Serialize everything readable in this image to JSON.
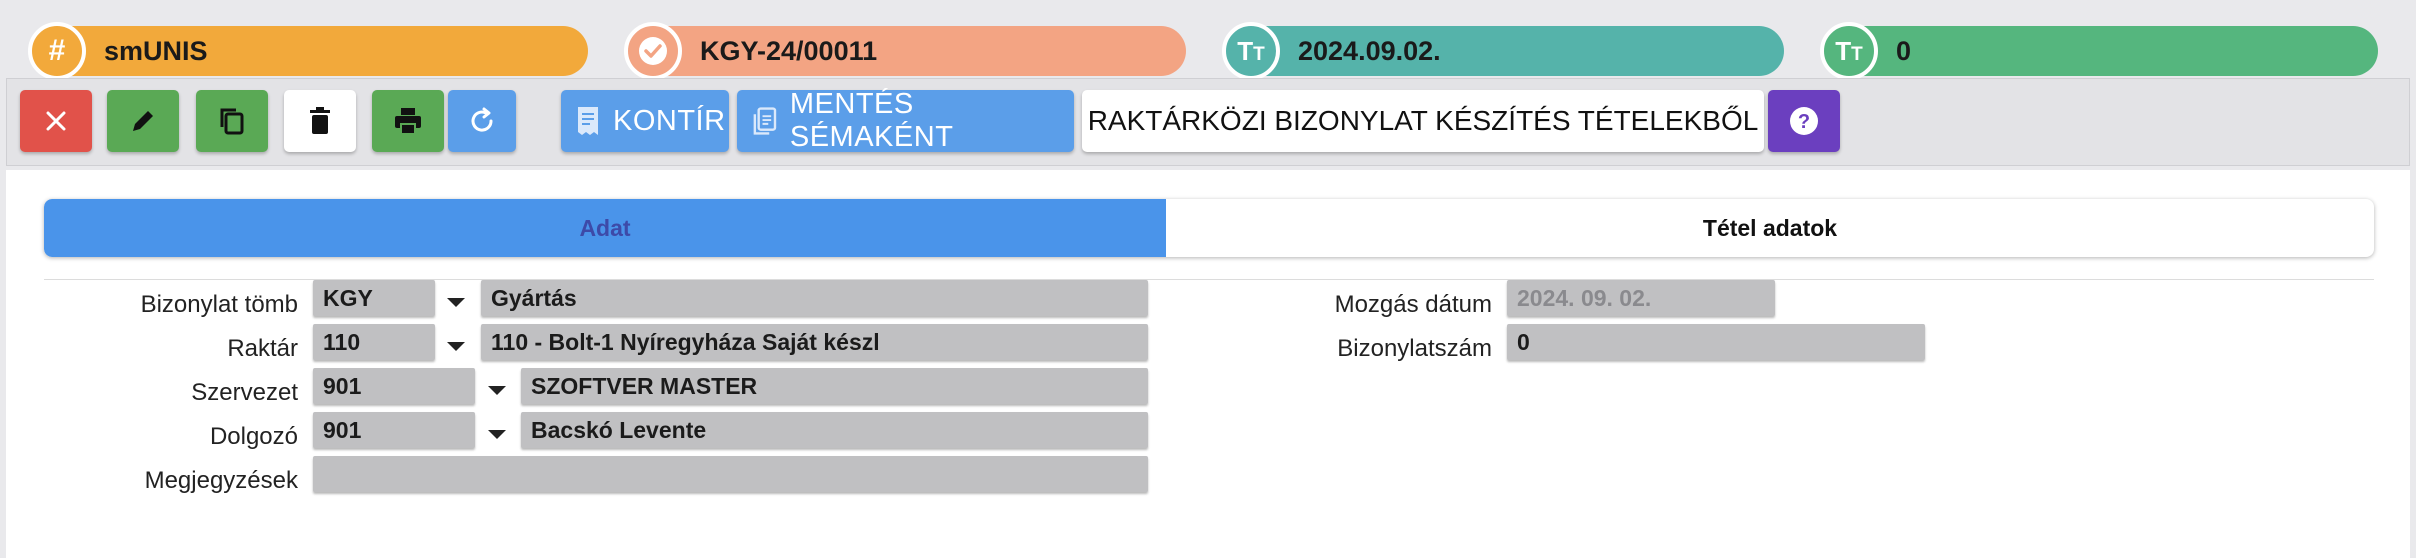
{
  "header": {
    "pills": [
      {
        "icon": "hash-icon",
        "value": "smUNIS",
        "color": "#f2a93b"
      },
      {
        "icon": "check-badge-icon",
        "value": "KGY-24/00011",
        "color": "#f3a483"
      },
      {
        "icon": "text-format-icon",
        "value": "2024.09.02.",
        "color": "#55b3aa"
      },
      {
        "icon": "text-format-icon",
        "value": "0",
        "color": "#55b67e"
      }
    ]
  },
  "toolbar": {
    "close_icon": "close-icon",
    "edit_icon": "pencil-icon",
    "copy_icon": "copy-icon",
    "delete_icon": "trash-icon",
    "print_icon": "printer-icon",
    "refresh_icon": "refresh-icon",
    "kontir_label": "KONTÍR",
    "save_schema_label": "MENTÉS SÉMAKÉNT",
    "create_doc_label": "RAKTÁRKÖZI BIZONYLAT KÉSZÍTÉS TÉTELEKBŐL",
    "help_icon": "question-icon",
    "colors": {
      "red": "#e1524a",
      "green": "#5aa955",
      "blue": "#5b9ee9",
      "purple": "#6b3fbf"
    }
  },
  "tabs": [
    {
      "label": "Adat",
      "active": true
    },
    {
      "label": "Tétel adatok",
      "active": false
    }
  ],
  "form": {
    "bizonylat_tomb": {
      "label": "Bizonylat tömb",
      "code": "KGY",
      "name": "Gyártás"
    },
    "raktar": {
      "label": "Raktár",
      "code": "110",
      "name": "110 - Bolt-1 Nyíregyháza Saját készl"
    },
    "szervezet": {
      "label": "Szervezet",
      "code": "901",
      "name": "SZOFTVER MASTER"
    },
    "dolgozo": {
      "label": "Dolgozó",
      "code": "901",
      "name": "Bacskó Levente"
    },
    "megjegyzesek": {
      "label": "Megjegyzések",
      "value": ""
    },
    "mozgas_datum": {
      "label": "Mozgás dátum",
      "value": "2024. 09. 02."
    },
    "bizonylatszam": {
      "label": "Bizonylatszám",
      "value": "0"
    }
  }
}
